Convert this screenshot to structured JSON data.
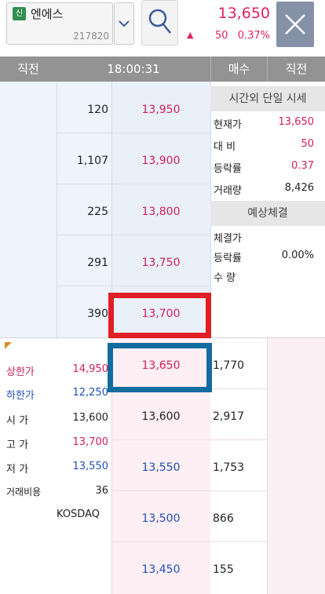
{
  "header": {
    "badge": "신",
    "stock_name": "엔에스",
    "stock_code": "217820",
    "price": "13,650",
    "up_symbol": "▲",
    "diff": "50",
    "rate": "0.37%",
    "accent": "#e0245e"
  },
  "columns": {
    "prev1": "직전",
    "time": "18:00:31",
    "bid": "매수",
    "prev2": "직전"
  },
  "asks": [
    {
      "qty": "120",
      "price": "13,950"
    },
    {
      "qty": "1,107",
      "price": "13,900"
    },
    {
      "qty": "225",
      "price": "13,800"
    },
    {
      "qty": "291",
      "price": "13,750"
    },
    {
      "qty": "390",
      "price": "13,700"
    }
  ],
  "bids": [
    {
      "price": "13,650",
      "qty": "1,770"
    },
    {
      "price": "13,600",
      "qty": "2,917"
    },
    {
      "price": "13,550",
      "qty": "1,753"
    },
    {
      "price": "13,500",
      "qty": "866"
    },
    {
      "price": "13,450",
      "qty": "155"
    }
  ],
  "overtime": {
    "title": "시간외 단일 시세",
    "rows": [
      {
        "label": "현재가",
        "value": "13,650"
      },
      {
        "label": "대    비",
        "value": "50"
      },
      {
        "label": "등락률",
        "value": "0.37"
      },
      {
        "label": "거래량",
        "value": "8,426"
      }
    ]
  },
  "expected": {
    "title": "예상체결",
    "price_label": "체결가",
    "rate_label": "등락률",
    "rate_value": "0.00%",
    "qty_label": "수    량"
  },
  "stats": [
    {
      "label": "상한가",
      "value": "14,950"
    },
    {
      "label": "하한가",
      "value": "12,250"
    },
    {
      "label": "시    가",
      "value": "13,600"
    },
    {
      "label": "고    가",
      "value": "13,700"
    },
    {
      "label": "저    가",
      "value": "13,550"
    },
    {
      "label": "거래비용",
      "value": "36"
    }
  ],
  "market": "KOSDAQ",
  "colors": {
    "up": "#d1205a",
    "down": "#1f4fb5",
    "highlight_red": "#e01e24",
    "highlight_blue": "#126d9f"
  }
}
